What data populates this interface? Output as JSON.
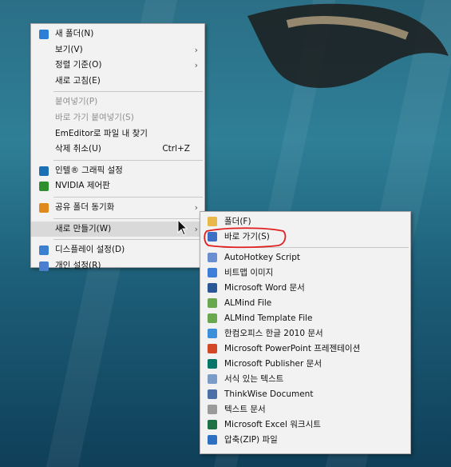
{
  "context_menu": {
    "items": [
      {
        "label": "새 폴더(N)",
        "icon": "new-folder-icon",
        "color": "#2d7fd6"
      },
      {
        "label": "보기(V)",
        "arrow": true
      },
      {
        "label": "정렬 기준(O)",
        "arrow": true
      },
      {
        "label": "새로 고침(E)"
      },
      {
        "label": "붙여넣기(P)",
        "disabled": true
      },
      {
        "label": "바로 가기 붙여넣기(S)",
        "disabled": true
      },
      {
        "label": "EmEditor로 파일 내 찾기"
      },
      {
        "label": "삭제 취소(U)",
        "shortcut": "Ctrl+Z"
      },
      {
        "label": "인텔® 그래픽 설정",
        "icon": "intel-graphics-icon",
        "color": "#1a6fb5"
      },
      {
        "label": "NVIDIA 제어판",
        "icon": "nvidia-icon",
        "color": "#2f8f2f"
      },
      {
        "label": "공유 폴더 동기화",
        "icon": "sync-folder-icon",
        "color": "#e08a1e",
        "arrow": true
      },
      {
        "label": "새로 만들기(W)",
        "arrow": true,
        "hover": true
      },
      {
        "label": "디스플레이 설정(D)",
        "icon": "display-settings-icon",
        "color": "#3a7fd0"
      },
      {
        "label": "개인 설정(R)",
        "icon": "personalize-icon",
        "color": "#4a7fcf"
      }
    ]
  },
  "submenu": {
    "items": [
      {
        "label": "폴더(F)",
        "icon": "folder-icon",
        "color": "#e8b84a"
      },
      {
        "label": "바로 가기(S)",
        "icon": "shortcut-icon",
        "color": "#3b6fc4"
      },
      {
        "label": "AutoHotkey Script",
        "icon": "ahk-script-icon",
        "color": "#6a8fd0"
      },
      {
        "label": "비트맵 이미지",
        "icon": "bitmap-icon",
        "color": "#3f7ed8"
      },
      {
        "label": "Microsoft Word 문서",
        "icon": "word-icon",
        "color": "#2b5797"
      },
      {
        "label": "ALMind File",
        "icon": "almind-icon",
        "color": "#6aa84f"
      },
      {
        "label": "ALMind Template File",
        "icon": "almind-template-icon",
        "color": "#6aa84f"
      },
      {
        "label": "한컴오피스 한글 2010 문서",
        "icon": "hwp-icon",
        "color": "#3c8fd8"
      },
      {
        "label": "Microsoft PowerPoint 프레젠테이션",
        "icon": "powerpoint-icon",
        "color": "#d24726"
      },
      {
        "label": "Microsoft Publisher 문서",
        "icon": "publisher-icon",
        "color": "#077568"
      },
      {
        "label": "서식 있는 텍스트",
        "icon": "rich-text-icon",
        "color": "#7a9cc6"
      },
      {
        "label": "ThinkWise Document",
        "icon": "thinkwise-icon",
        "color": "#4c6fa8"
      },
      {
        "label": "텍스트 문서",
        "icon": "text-document-icon",
        "color": "#9a9a9a"
      },
      {
        "label": "Microsoft Excel 워크시트",
        "icon": "excel-icon",
        "color": "#1e7145"
      },
      {
        "label": "압축(ZIP) 파일",
        "icon": "zip-icon",
        "color": "#2d6fc0"
      }
    ]
  }
}
